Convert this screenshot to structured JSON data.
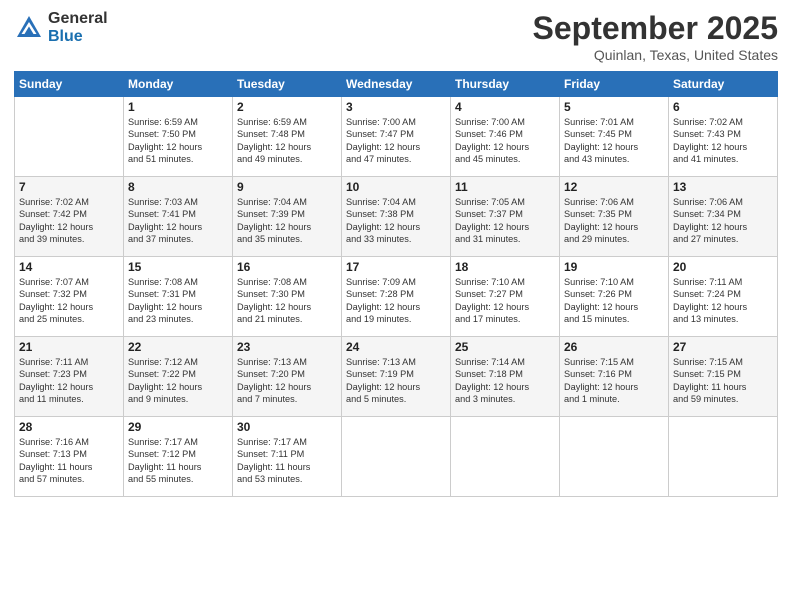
{
  "header": {
    "logo_general": "General",
    "logo_blue": "Blue",
    "month": "September 2025",
    "location": "Quinlan, Texas, United States"
  },
  "weekdays": [
    "Sunday",
    "Monday",
    "Tuesday",
    "Wednesday",
    "Thursday",
    "Friday",
    "Saturday"
  ],
  "weeks": [
    [
      {
        "day": "",
        "info": ""
      },
      {
        "day": "1",
        "info": "Sunrise: 6:59 AM\nSunset: 7:50 PM\nDaylight: 12 hours\nand 51 minutes."
      },
      {
        "day": "2",
        "info": "Sunrise: 6:59 AM\nSunset: 7:48 PM\nDaylight: 12 hours\nand 49 minutes."
      },
      {
        "day": "3",
        "info": "Sunrise: 7:00 AM\nSunset: 7:47 PM\nDaylight: 12 hours\nand 47 minutes."
      },
      {
        "day": "4",
        "info": "Sunrise: 7:00 AM\nSunset: 7:46 PM\nDaylight: 12 hours\nand 45 minutes."
      },
      {
        "day": "5",
        "info": "Sunrise: 7:01 AM\nSunset: 7:45 PM\nDaylight: 12 hours\nand 43 minutes."
      },
      {
        "day": "6",
        "info": "Sunrise: 7:02 AM\nSunset: 7:43 PM\nDaylight: 12 hours\nand 41 minutes."
      }
    ],
    [
      {
        "day": "7",
        "info": "Sunrise: 7:02 AM\nSunset: 7:42 PM\nDaylight: 12 hours\nand 39 minutes."
      },
      {
        "day": "8",
        "info": "Sunrise: 7:03 AM\nSunset: 7:41 PM\nDaylight: 12 hours\nand 37 minutes."
      },
      {
        "day": "9",
        "info": "Sunrise: 7:04 AM\nSunset: 7:39 PM\nDaylight: 12 hours\nand 35 minutes."
      },
      {
        "day": "10",
        "info": "Sunrise: 7:04 AM\nSunset: 7:38 PM\nDaylight: 12 hours\nand 33 minutes."
      },
      {
        "day": "11",
        "info": "Sunrise: 7:05 AM\nSunset: 7:37 PM\nDaylight: 12 hours\nand 31 minutes."
      },
      {
        "day": "12",
        "info": "Sunrise: 7:06 AM\nSunset: 7:35 PM\nDaylight: 12 hours\nand 29 minutes."
      },
      {
        "day": "13",
        "info": "Sunrise: 7:06 AM\nSunset: 7:34 PM\nDaylight: 12 hours\nand 27 minutes."
      }
    ],
    [
      {
        "day": "14",
        "info": "Sunrise: 7:07 AM\nSunset: 7:32 PM\nDaylight: 12 hours\nand 25 minutes."
      },
      {
        "day": "15",
        "info": "Sunrise: 7:08 AM\nSunset: 7:31 PM\nDaylight: 12 hours\nand 23 minutes."
      },
      {
        "day": "16",
        "info": "Sunrise: 7:08 AM\nSunset: 7:30 PM\nDaylight: 12 hours\nand 21 minutes."
      },
      {
        "day": "17",
        "info": "Sunrise: 7:09 AM\nSunset: 7:28 PM\nDaylight: 12 hours\nand 19 minutes."
      },
      {
        "day": "18",
        "info": "Sunrise: 7:10 AM\nSunset: 7:27 PM\nDaylight: 12 hours\nand 17 minutes."
      },
      {
        "day": "19",
        "info": "Sunrise: 7:10 AM\nSunset: 7:26 PM\nDaylight: 12 hours\nand 15 minutes."
      },
      {
        "day": "20",
        "info": "Sunrise: 7:11 AM\nSunset: 7:24 PM\nDaylight: 12 hours\nand 13 minutes."
      }
    ],
    [
      {
        "day": "21",
        "info": "Sunrise: 7:11 AM\nSunset: 7:23 PM\nDaylight: 12 hours\nand 11 minutes."
      },
      {
        "day": "22",
        "info": "Sunrise: 7:12 AM\nSunset: 7:22 PM\nDaylight: 12 hours\nand 9 minutes."
      },
      {
        "day": "23",
        "info": "Sunrise: 7:13 AM\nSunset: 7:20 PM\nDaylight: 12 hours\nand 7 minutes."
      },
      {
        "day": "24",
        "info": "Sunrise: 7:13 AM\nSunset: 7:19 PM\nDaylight: 12 hours\nand 5 minutes."
      },
      {
        "day": "25",
        "info": "Sunrise: 7:14 AM\nSunset: 7:18 PM\nDaylight: 12 hours\nand 3 minutes."
      },
      {
        "day": "26",
        "info": "Sunrise: 7:15 AM\nSunset: 7:16 PM\nDaylight: 12 hours\nand 1 minute."
      },
      {
        "day": "27",
        "info": "Sunrise: 7:15 AM\nSunset: 7:15 PM\nDaylight: 11 hours\nand 59 minutes."
      }
    ],
    [
      {
        "day": "28",
        "info": "Sunrise: 7:16 AM\nSunset: 7:13 PM\nDaylight: 11 hours\nand 57 minutes."
      },
      {
        "day": "29",
        "info": "Sunrise: 7:17 AM\nSunset: 7:12 PM\nDaylight: 11 hours\nand 55 minutes."
      },
      {
        "day": "30",
        "info": "Sunrise: 7:17 AM\nSunset: 7:11 PM\nDaylight: 11 hours\nand 53 minutes."
      },
      {
        "day": "",
        "info": ""
      },
      {
        "day": "",
        "info": ""
      },
      {
        "day": "",
        "info": ""
      },
      {
        "day": "",
        "info": ""
      }
    ]
  ]
}
